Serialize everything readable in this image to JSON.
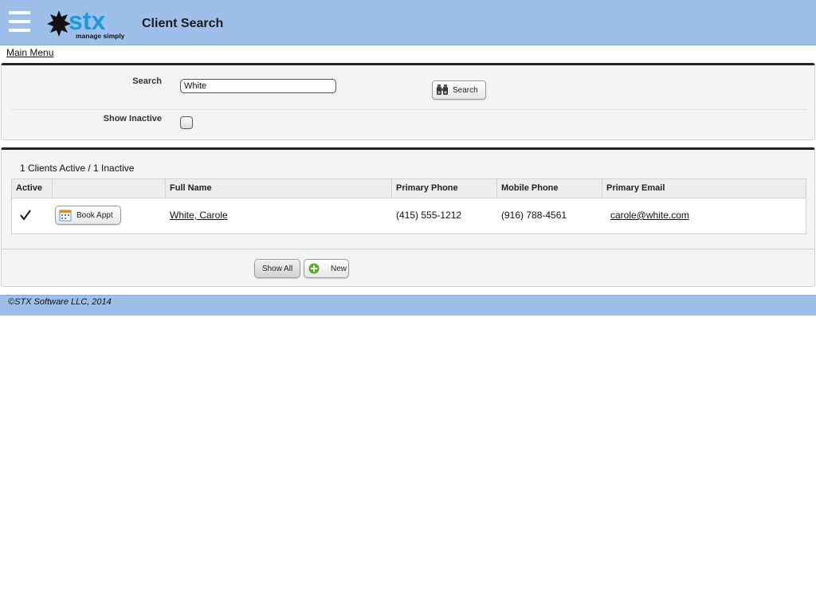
{
  "header": {
    "title": "Client Search",
    "logo_text": "stx",
    "logo_tagline": "manage simply",
    "bg_color": "#9dbfea",
    "menu_icon": "hamburger-icon"
  },
  "nav": {
    "main_menu_label": "Main Menu"
  },
  "search_panel": {
    "search_label": "Search",
    "search_value": "White",
    "search_button_label": "Search",
    "search_button_icon": "binoculars-icon",
    "show_inactive_label": "Show Inactive",
    "show_inactive_checked": false
  },
  "results": {
    "summary": "1 Clients Active / 1 Inactive",
    "columns": [
      "Active",
      "",
      "Full Name",
      "Primary Phone",
      "Mobile Phone",
      "Primary Email"
    ],
    "rows": [
      {
        "active": true,
        "book_label": "Book Appt",
        "book_icon": "calendar-icon",
        "full_name": "White, Carole",
        "primary_phone": "(415) 555-1212",
        "mobile_phone": "(916) 788-4561",
        "primary_email": "carole@white.com"
      }
    ],
    "show_all_label": "Show All",
    "new_label": "New",
    "new_icon": "plus-circle-icon"
  },
  "footer": {
    "copyright": "©STX Software LLC, 2014"
  },
  "colors": {
    "accent": "#9dbfea",
    "logo_blue": "#1e9ad6",
    "new_green": "#5aac2e"
  }
}
